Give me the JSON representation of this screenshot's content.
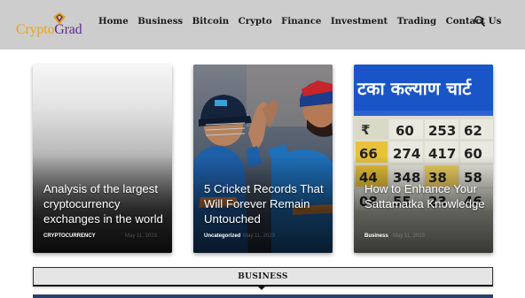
{
  "logo": {
    "part1": "Crypto",
    "part2": "Grad"
  },
  "nav": {
    "items": [
      {
        "label": "Home"
      },
      {
        "label": "Business"
      },
      {
        "label": "Bitcoin"
      },
      {
        "label": "Crypto"
      },
      {
        "label": "Finance"
      },
      {
        "label": "Investment"
      },
      {
        "label": "Trading"
      },
      {
        "label": "Contact Us"
      }
    ]
  },
  "search": {
    "icon": "search-icon"
  },
  "cards": [
    {
      "title": "Analysis of the largest cryptocurrency exchanges in the world",
      "category": "CRYPTOCURRENCY",
      "date": "May 11, 2023"
    },
    {
      "title": "5 Cricket Records That Will Forever Remain Untouched",
      "category": "Uncategorized",
      "date": "May 11, 2023"
    },
    {
      "title": "How to Enhance Your Sattamatka Knowledge",
      "category": "Business",
      "date": "May 11, 2023"
    }
  ],
  "sections": {
    "business": "BUSINESS"
  },
  "colors": {
    "header_bg": "#cdcdcd",
    "logo_orange": "#e8a317",
    "logo_purple": "#5b2c90",
    "chart_blue": "#1a55c8"
  }
}
